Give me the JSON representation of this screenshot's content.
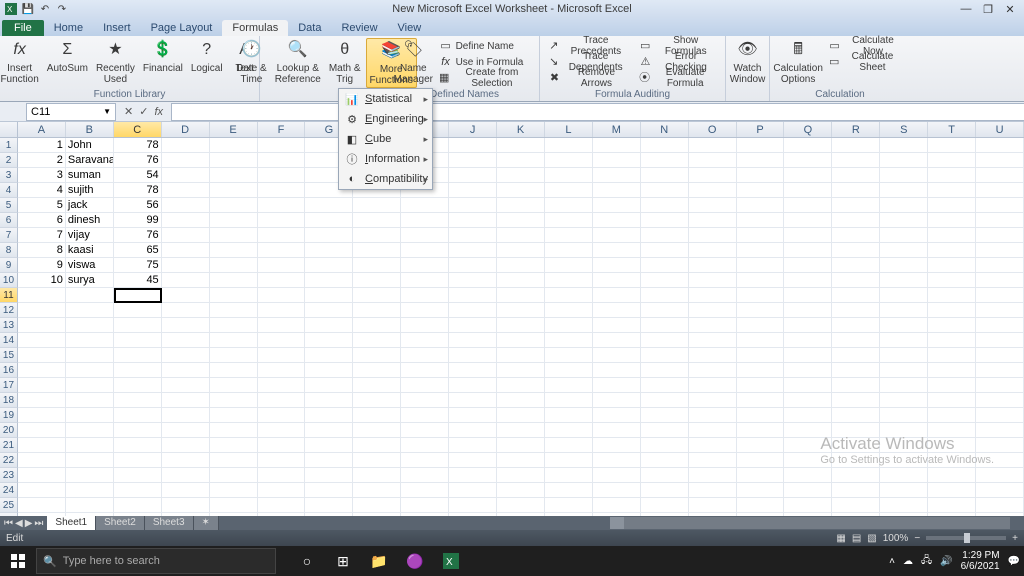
{
  "window": {
    "title": "New Microsoft Excel Worksheet - Microsoft Excel"
  },
  "tabs": {
    "file": "File",
    "items": [
      "Home",
      "Insert",
      "Page Layout",
      "Formulas",
      "Data",
      "Review",
      "View"
    ],
    "active": "Formulas"
  },
  "ribbon": {
    "insert_function": "Insert\nFunction",
    "autosum": "AutoSum",
    "recently_used": "Recently\nUsed",
    "financial": "Financial",
    "logical": "Logical",
    "text": "Text",
    "date_time": "Date &\nTime",
    "lookup": "Lookup &\nReference",
    "math_trig": "Math &\nTrig",
    "more_functions": "More\nFunctions",
    "group_function_library": "Function Library",
    "name_manager": "Name\nManager",
    "define_name": "Define Name",
    "use_in_formula": "Use in Formula",
    "create_from_selection": "Create from Selection",
    "group_defined_names": "Defined Names",
    "trace_precedents": "Trace Precedents",
    "trace_dependents": "Trace Dependents",
    "remove_arrows": "Remove Arrows",
    "show_formulas": "Show Formulas",
    "error_checking": "Error Checking",
    "evaluate_formula": "Evaluate Formula",
    "group_formula_auditing": "Formula Auditing",
    "watch_window": "Watch\nWindow",
    "calculation_options": "Calculation\nOptions",
    "calculate_now": "Calculate Now",
    "calculate_sheet": "Calculate Sheet",
    "group_calculation": "Calculation"
  },
  "menu": {
    "statistical": "tatistical",
    "engineering": "ngineering",
    "cube": "ube",
    "information": "nformation",
    "compatibility": "ompatibility",
    "pre": {
      "s": "S",
      "e": "E",
      "c": "C",
      "i": "I",
      "co": "C"
    }
  },
  "namebox": "C11",
  "columns": [
    "A",
    "B",
    "C",
    "D",
    "E",
    "F",
    "G",
    "H",
    "I",
    "J",
    "K",
    "L",
    "M",
    "N",
    "O",
    "P",
    "Q",
    "R",
    "S",
    "T",
    "U"
  ],
  "selected_col_index": 2,
  "selected_row_index": 10,
  "rowcount": 26,
  "cells": {
    "1": {
      "A": "1",
      "B": "John",
      "C": "78"
    },
    "2": {
      "A": "2",
      "B": "Saravanan",
      "C": "76"
    },
    "3": {
      "A": "3",
      "B": "suman",
      "C": "54"
    },
    "4": {
      "A": "4",
      "B": "sujith",
      "C": "78"
    },
    "5": {
      "A": "5",
      "B": "jack",
      "C": "56"
    },
    "6": {
      "A": "6",
      "B": "dinesh",
      "C": "99"
    },
    "7": {
      "A": "7",
      "B": "vijay",
      "C": "76"
    },
    "8": {
      "A": "8",
      "B": "kaasi",
      "C": "65"
    },
    "9": {
      "A": "9",
      "B": "viswa",
      "C": "75"
    },
    "10": {
      "A": "10",
      "B": "surya",
      "C": "45"
    }
  },
  "sheets": {
    "items": [
      "Sheet1",
      "Sheet2",
      "Sheet3"
    ],
    "active": "Sheet1"
  },
  "status": {
    "mode": "Edit",
    "zoom": "100%"
  },
  "watermark": {
    "l1": "Activate Windows",
    "l2": "Go to Settings to activate Windows."
  },
  "taskbar": {
    "search_placeholder": "Type here to search",
    "time": "1:29 PM",
    "date": "6/6/2021"
  }
}
